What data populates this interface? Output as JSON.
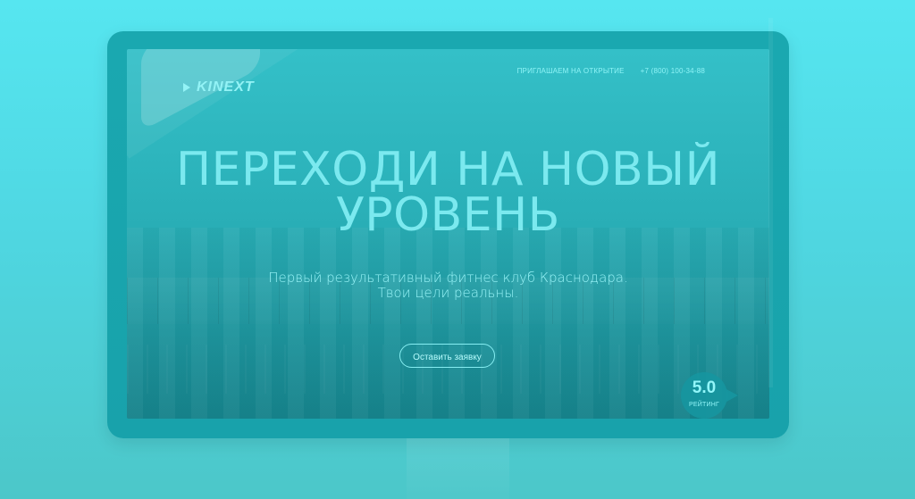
{
  "brand": {
    "name": "KINEXT"
  },
  "nav": {
    "opening_text": "ПРИГЛАШАЕМ НА ОТКРЫТИЕ",
    "phone": "+7 (800) 100-34-88"
  },
  "hero": {
    "title_line1": "ПЕРЕХОДИ НА НОВЫЙ",
    "title_line2": "УРОВЕНЬ",
    "subtitle_line1": "Первый результативный фитнес клуб Краснодара.",
    "subtitle_line2": "Твои цели реальны.",
    "cta_label": "Оставить заявку"
  },
  "rating": {
    "value": "5.0",
    "label": "РЕЙТИНГ"
  },
  "colors": {
    "background": "#56e6f0",
    "monitor": "#1aa8b0",
    "text": "#7be9ef"
  },
  "icons": {
    "logo_mark": "play-triangle-icon"
  }
}
